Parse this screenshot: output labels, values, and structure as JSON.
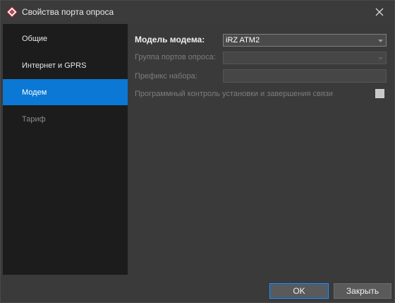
{
  "window": {
    "title": "Свойства порта опроса"
  },
  "sidebar": {
    "items": [
      {
        "label": "Общие",
        "state": "normal"
      },
      {
        "label": "Интернет и GPRS",
        "state": "normal"
      },
      {
        "label": "Модем",
        "state": "active"
      },
      {
        "label": "Тариф",
        "state": "disabled"
      }
    ]
  },
  "form": {
    "modem_model_label": "Модель модема:",
    "modem_model_value": "iRZ ATM2",
    "port_group_label": "Группа портов опроса:",
    "port_group_value": "",
    "dial_prefix_label": "Префикс набора:",
    "dial_prefix_value": "",
    "program_control_label": "Программный контроль установки и завершения связи",
    "program_control_checked": false
  },
  "footer": {
    "ok_label": "OK",
    "close_label": "Закрыть"
  },
  "colors": {
    "accent": "#0a78d4",
    "background": "#3a3a3a",
    "sidebar": "#1c1c1c"
  },
  "icons": {
    "app": "app-diamond-icon",
    "close": "close-icon",
    "dropdown": "chevron-down-icon"
  }
}
